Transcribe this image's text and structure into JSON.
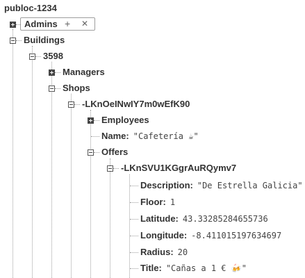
{
  "root": {
    "title": "publoc-1234"
  },
  "admins": {
    "label": "Admins",
    "add_icon": "+",
    "remove_icon": "✕"
  },
  "buildings": {
    "label": "Buildings"
  },
  "building_3598": {
    "label": "3598"
  },
  "managers": {
    "label": "Managers"
  },
  "shops": {
    "label": "Shops"
  },
  "shop": {
    "key": "-LKnOeINwIY7m0wEfK90"
  },
  "employees": {
    "label": "Employees"
  },
  "shop_name": {
    "key": "Name:",
    "value": "\"Cafetería ☕\""
  },
  "offers": {
    "label": "Offers"
  },
  "offer": {
    "key": "-LKnSVU1KGgrAuRQymv7"
  },
  "fields": {
    "description": {
      "key": "Description:",
      "value": "\"De Estrella Galicia\""
    },
    "floor": {
      "key": "Floor:",
      "value": "1"
    },
    "latitude": {
      "key": "Latitude:",
      "value": "43.33285284655736"
    },
    "longitude": {
      "key": "Longitude:",
      "value": "-8.411015197634697"
    },
    "radius": {
      "key": "Radius:",
      "value": "20"
    },
    "title": {
      "key": "Title:",
      "value": "\"Cañas a 1 € 🍻\""
    }
  }
}
